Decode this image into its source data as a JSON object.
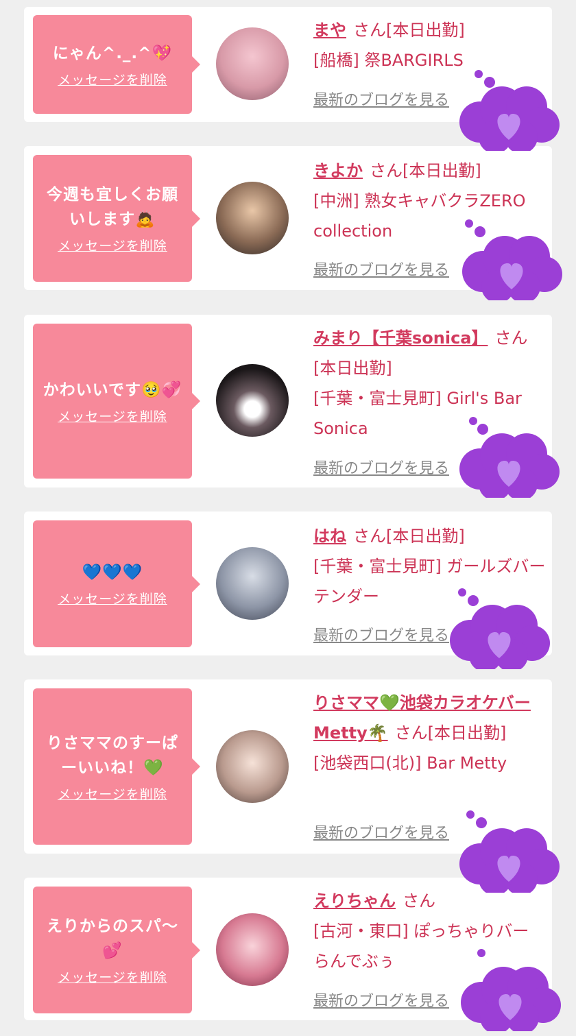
{
  "delete_label": "メッセージを削除",
  "blog_label": "最新のブログを見る",
  "san": "さん",
  "cards": [
    {
      "message": "にゃん^._.^💖",
      "name": "まや",
      "status": "[本日出勤]",
      "shop": "[船橋] 祭BARGIRLS"
    },
    {
      "message": "今週も宜しくお願いします🙇",
      "name": "きよか",
      "status": "[本日出勤]",
      "shop": "[中洲] 熟女キャバクラZERO collection"
    },
    {
      "message": "かわいいです🥹💞",
      "name": "みまり【千葉sonica】",
      "status": "[本日出勤]",
      "shop": "[千葉・富士見町] Girl's Bar Sonica"
    },
    {
      "message": "💙💙💙",
      "name": "はね",
      "status": "[本日出勤]",
      "shop": "[千葉・富士見町] ガールズバー テンダー"
    },
    {
      "message": "りさママのすーぱーいいね！💚",
      "name": "りさママ💚池袋カラオケバーMetty🌴",
      "status": "[本日出勤]",
      "shop": "[池袋西口(北)] Bar Metty"
    },
    {
      "message": "えりからのスパ〜💕",
      "name": "えりちゃん",
      "status": "",
      "shop": "[古河・東口] ぽっちゃりバー らんでぶぅ"
    }
  ],
  "colors": {
    "background": "#efefef",
    "bubble": "#f7899a",
    "name": "#d23a5e",
    "shop": "#cc3355",
    "blog_link": "#888888",
    "sticker": "#9b3fd6"
  }
}
